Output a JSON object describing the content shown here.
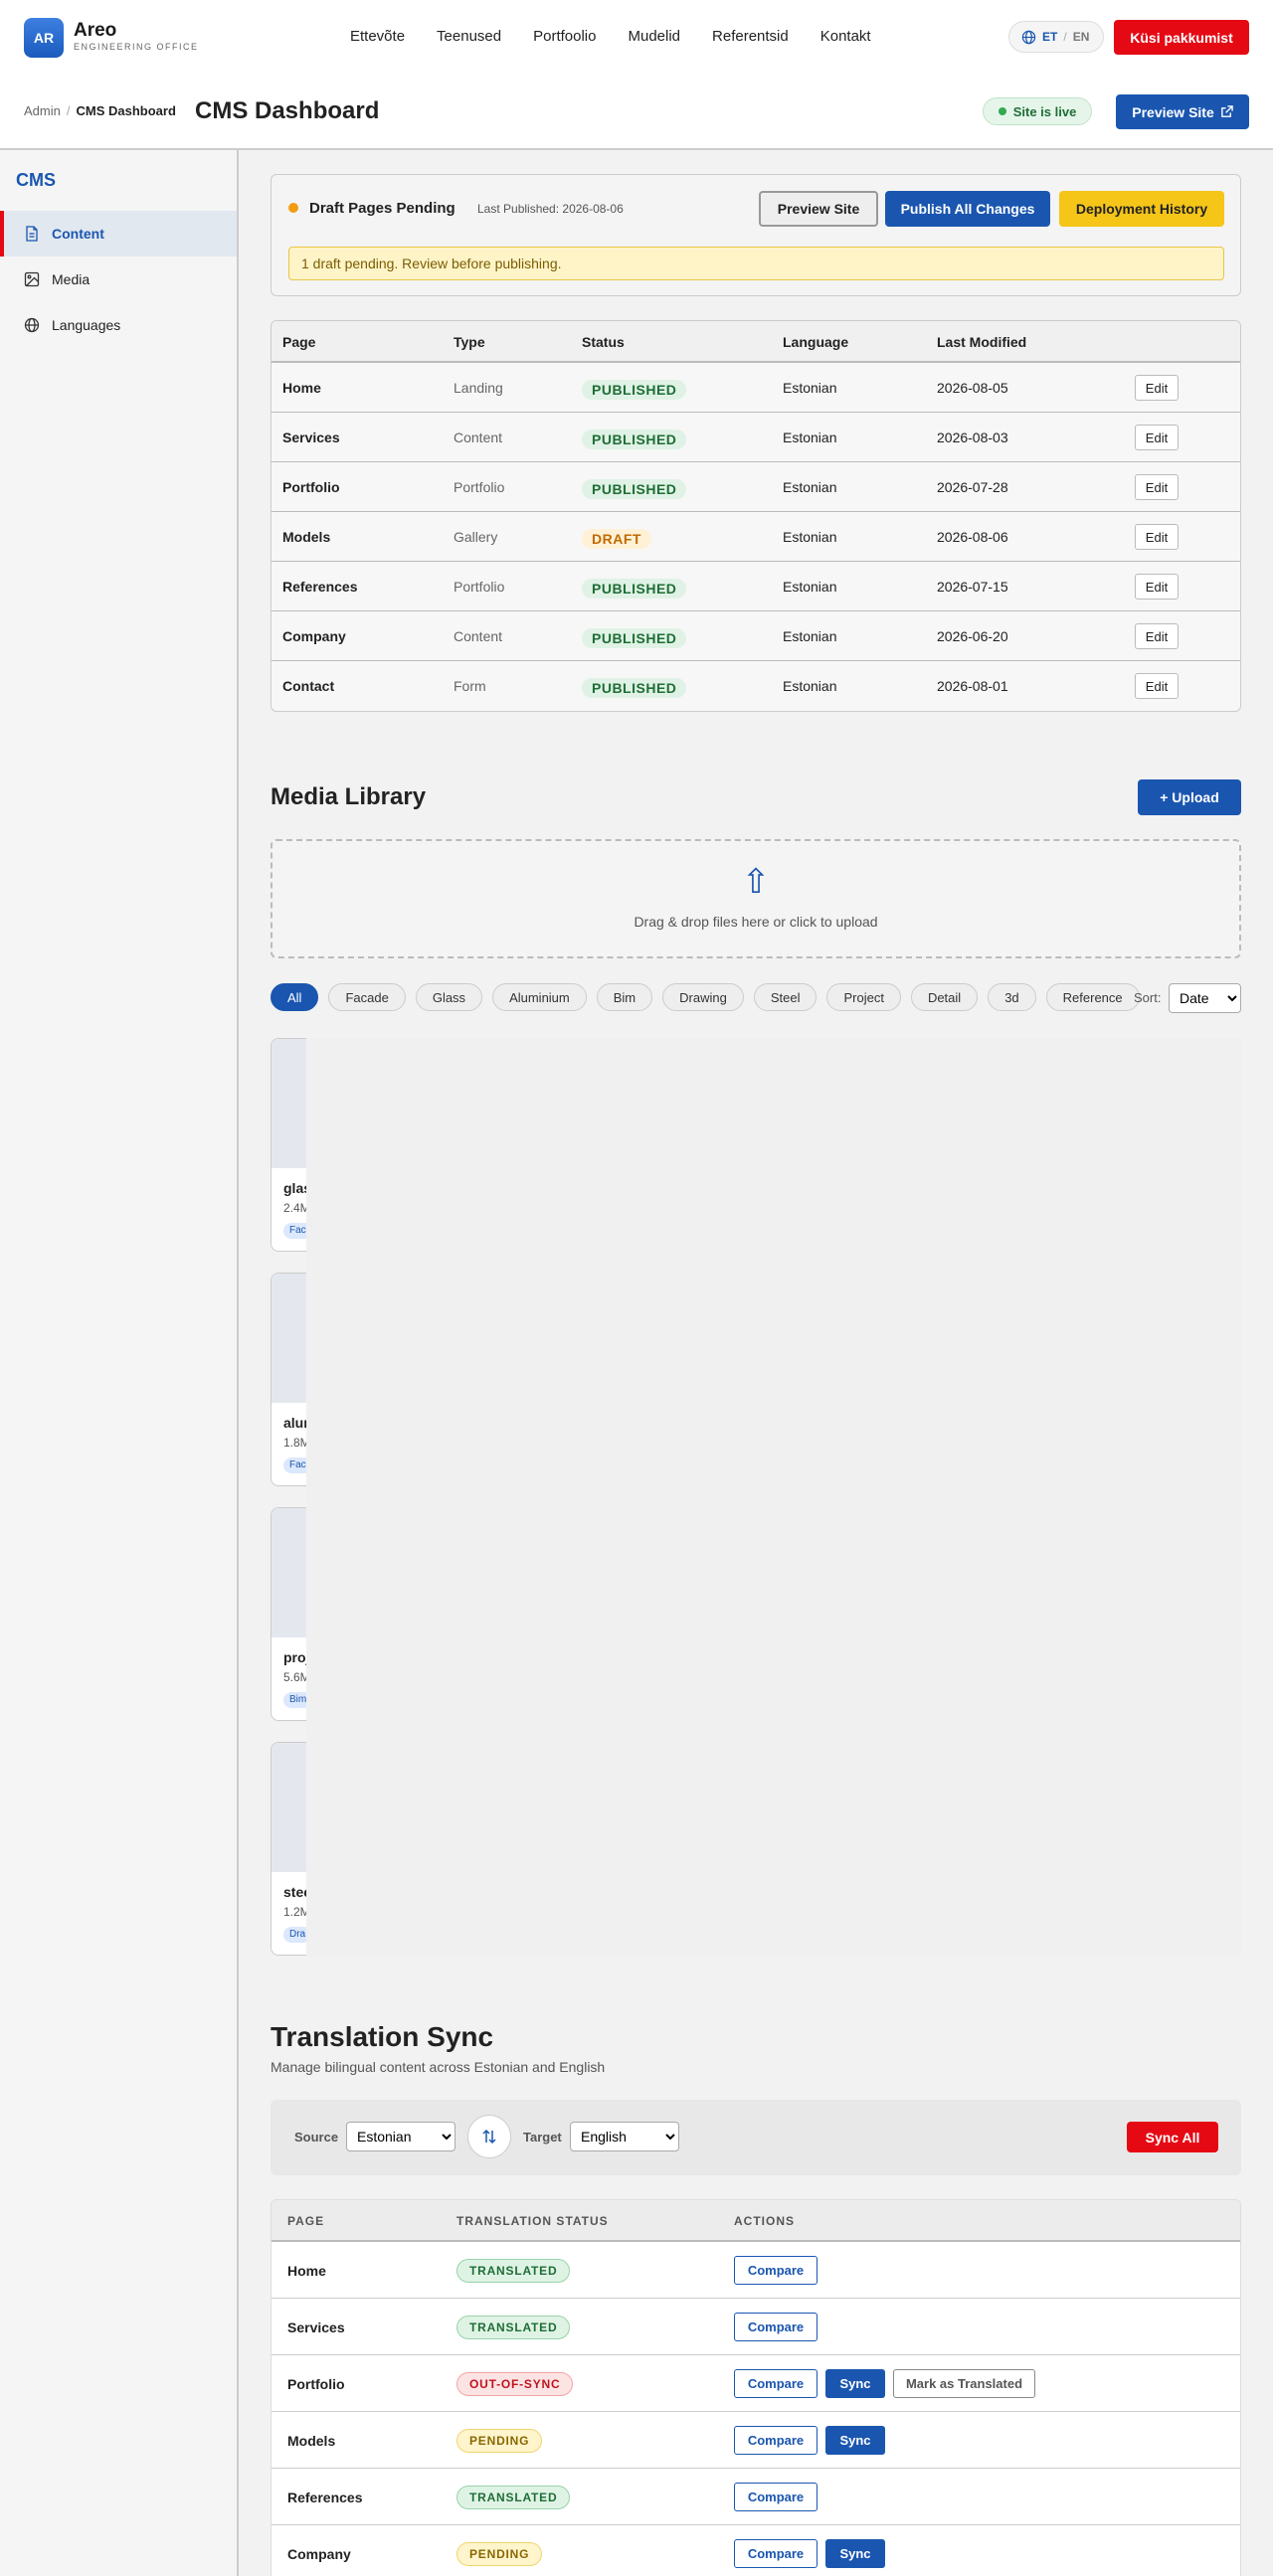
{
  "brand": {
    "initials": "AR",
    "name": "Areo",
    "subtitle": "ENGINEERING OFFICE"
  },
  "nav": [
    "Ettevõte",
    "Teenused",
    "Portfoolio",
    "Mudelid",
    "Referentsid",
    "Kontakt"
  ],
  "lang": {
    "active": "ET",
    "inactive": "EN",
    "separator": "/"
  },
  "cta_label": "Küsi pakkumist",
  "header": {
    "breadcrumb_root": "Admin",
    "breadcrumb_current": "CMS Dashboard",
    "title": "CMS Dashboard",
    "live_status": "Site is live",
    "preview_label": "Preview Site"
  },
  "sidebar": {
    "title": "CMS",
    "items": [
      {
        "label": "Content",
        "icon": "document-icon",
        "active": true
      },
      {
        "label": "Media",
        "icon": "image-icon",
        "active": false
      },
      {
        "label": "Languages",
        "icon": "globe-icon",
        "active": false
      }
    ]
  },
  "draft": {
    "title": "Draft Pages Pending",
    "last_published": "Last Published: 2026-08-06",
    "preview_label": "Preview Site",
    "publish_label": "Publish All Changes",
    "history_label": "Deployment History",
    "alert": "1 draft pending. Review before publishing."
  },
  "pages_table": {
    "headers": [
      "Page",
      "Type",
      "Status",
      "Language",
      "Last Modified"
    ],
    "edit_label": "Edit",
    "rows": [
      {
        "page": "Home",
        "type": "Landing",
        "status": "PUBLISHED",
        "language": "Estonian",
        "modified": "2026-08-05"
      },
      {
        "page": "Services",
        "type": "Content",
        "status": "PUBLISHED",
        "language": "Estonian",
        "modified": "2026-08-03"
      },
      {
        "page": "Portfolio",
        "type": "Portfolio",
        "status": "PUBLISHED",
        "language": "Estonian",
        "modified": "2026-07-28"
      },
      {
        "page": "Models",
        "type": "Gallery",
        "status": "DRAFT",
        "language": "Estonian",
        "modified": "2026-08-06"
      },
      {
        "page": "References",
        "type": "Portfolio",
        "status": "PUBLISHED",
        "language": "Estonian",
        "modified": "2026-07-15"
      },
      {
        "page": "Company",
        "type": "Content",
        "status": "PUBLISHED",
        "language": "Estonian",
        "modified": "2026-06-20"
      },
      {
        "page": "Contact",
        "type": "Form",
        "status": "PUBLISHED",
        "language": "Estonian",
        "modified": "2026-08-01"
      }
    ]
  },
  "media": {
    "title": "Media Library",
    "upload_label": "+ Upload",
    "drop_arrow": "⇧",
    "drop_text": "Drag & drop files here or click to upload",
    "filters": [
      "All",
      "Facade",
      "Glass",
      "Aluminium",
      "Bim",
      "Drawing",
      "Steel",
      "Project",
      "Detail",
      "3d",
      "Reference"
    ],
    "active_filter": "All",
    "sort_label": "Sort:",
    "sort_value": "Date",
    "cards": [
      {
        "name": "glas",
        "size": "2.4M",
        "tag": "Fac"
      },
      {
        "name": "alun",
        "size": "1.8M",
        "tag": "Fac"
      },
      {
        "name": "proj",
        "size": "5.6M",
        "tag": "Bim"
      },
      {
        "name": "stee",
        "size": "1.2M",
        "tag": "Dra"
      }
    ]
  },
  "translation": {
    "title": "Translation Sync",
    "subtitle": "Manage bilingual content across Estonian and English",
    "source_label": "Source",
    "source_value": "Estonian",
    "target_label": "Target",
    "target_value": "English",
    "sync_all_label": "Sync All",
    "headers": [
      "PAGE",
      "TRANSLATION STATUS",
      "ACTIONS"
    ],
    "compare_label": "Compare",
    "sync_label": "Sync",
    "mark_label": "Mark as Translated",
    "rows": [
      {
        "page": "Home",
        "status": "TRANSLATED"
      },
      {
        "page": "Services",
        "status": "TRANSLATED"
      },
      {
        "page": "Portfolio",
        "status": "OUT-OF-SYNC"
      },
      {
        "page": "Models",
        "status": "PENDING"
      },
      {
        "page": "References",
        "status": "TRANSLATED"
      },
      {
        "page": "Company",
        "status": "PENDING"
      }
    ]
  },
  "colors": {
    "brand_blue": "#1a56b0",
    "accent_red": "#e50914",
    "warning_yellow": "#f5c518"
  }
}
